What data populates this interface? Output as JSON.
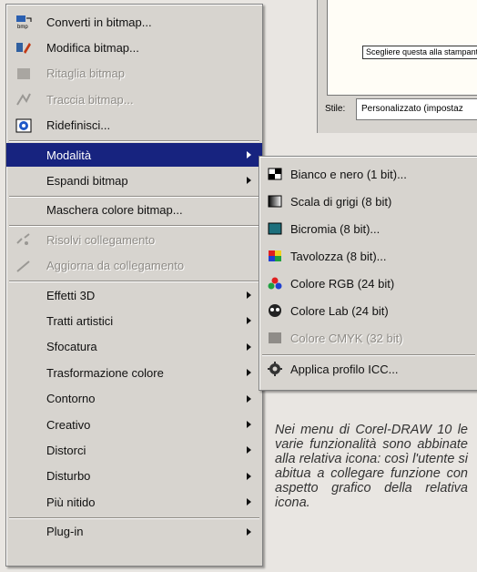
{
  "main_menu": {
    "items": [
      {
        "label": "Converti in bitmap...",
        "icon": "bitmap-convert-icon",
        "disabled": false,
        "has_submenu": false,
        "icon_color": "#2a5fb0"
      },
      {
        "label": "Modifica bitmap...",
        "icon": "bitmap-edit-icon",
        "disabled": false,
        "has_submenu": false,
        "icon_color": "#b33a1a"
      },
      {
        "label": "Ritaglia bitmap",
        "icon": "crop-bitmap-icon",
        "disabled": true,
        "has_submenu": false,
        "icon_color": "#9a9894"
      },
      {
        "label": "Traccia bitmap...",
        "icon": "trace-bitmap-icon",
        "disabled": true,
        "has_submenu": false,
        "icon_color": "#9a9894"
      },
      {
        "label": "Ridefinisci...",
        "icon": "resample-icon",
        "disabled": false,
        "has_submenu": false,
        "icon_color": "#1f58c8"
      },
      {
        "label": "Modalità",
        "icon": "",
        "disabled": false,
        "has_submenu": true,
        "selected": true
      },
      {
        "label": "Espandi bitmap",
        "icon": "",
        "disabled": false,
        "has_submenu": true
      },
      {
        "label": "Maschera colore bitmap...",
        "icon": "",
        "disabled": false,
        "has_submenu": false
      },
      {
        "label": "Risolvi collegamento",
        "icon": "break-link-icon",
        "disabled": true,
        "has_submenu": false,
        "icon_color": "#9a9894"
      },
      {
        "label": "Aggiorna da collegamento",
        "icon": "update-link-icon",
        "disabled": true,
        "has_submenu": false,
        "icon_color": "#9a9894"
      },
      {
        "label": "Effetti 3D",
        "icon": "",
        "disabled": false,
        "has_submenu": true
      },
      {
        "label": "Tratti artistici",
        "icon": "",
        "disabled": false,
        "has_submenu": true
      },
      {
        "label": "Sfocatura",
        "icon": "",
        "disabled": false,
        "has_submenu": true
      },
      {
        "label": "Trasformazione colore",
        "icon": "",
        "disabled": false,
        "has_submenu": true
      },
      {
        "label": "Contorno",
        "icon": "",
        "disabled": false,
        "has_submenu": true
      },
      {
        "label": "Creativo",
        "icon": "",
        "disabled": false,
        "has_submenu": true
      },
      {
        "label": "Distorci",
        "icon": "",
        "disabled": false,
        "has_submenu": true
      },
      {
        "label": "Disturbo",
        "icon": "",
        "disabled": false,
        "has_submenu": true
      },
      {
        "label": "Più nitido",
        "icon": "",
        "disabled": false,
        "has_submenu": true
      },
      {
        "label": "Plug-in",
        "icon": "",
        "disabled": false,
        "has_submenu": true
      }
    ]
  },
  "submenu": {
    "items": [
      {
        "label": "Bianco e nero (1 bit)...",
        "icon": "black-white-icon",
        "disabled": false
      },
      {
        "label": "Scala di grigi (8 bit)",
        "icon": "grayscale-icon",
        "disabled": false
      },
      {
        "label": "Bicromia (8 bit)...",
        "icon": "duotone-icon",
        "disabled": false
      },
      {
        "label": "Tavolozza (8 bit)...",
        "icon": "palette-icon",
        "disabled": false
      },
      {
        "label": "Colore RGB (24 bit)",
        "icon": "rgb-icon",
        "disabled": false
      },
      {
        "label": "Colore Lab (24 bit)",
        "icon": "lab-icon",
        "disabled": false
      },
      {
        "label": "Colore CMYK (32 bit)",
        "icon": "cmyk-icon",
        "disabled": true
      },
      {
        "label": "Applica profilo ICC...",
        "icon": "icc-profile-icon",
        "disabled": false
      }
    ]
  },
  "dialog": {
    "note": "Scegliere questa alla stampante c l'output della sta",
    "stile_label": "Stile:",
    "stile_value": "Personalizzato (impostaz"
  },
  "caption": "Nei menu di Corel-DRAW 10 le varie funzionalità sono abbinate alla relativa icona: così l'utente si abitua a collegare funzione con aspetto grafico della relativa icona.",
  "colors": {
    "selection": "#17237f",
    "menu_bg": "#d7d4cf",
    "disabled_text": "#8e8b86"
  }
}
